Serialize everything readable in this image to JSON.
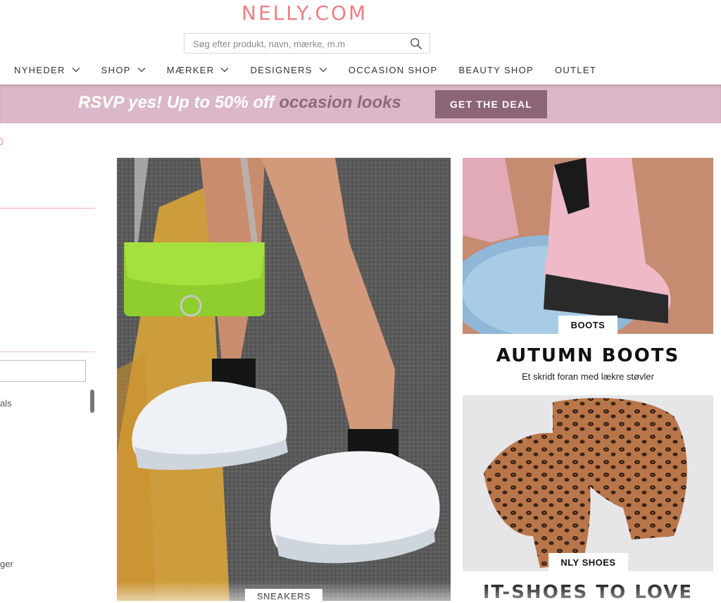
{
  "brand": {
    "logo": "NELLY.COM",
    "color": "#f07c84"
  },
  "search": {
    "placeholder": "Søg efter produkt, navn, mærke, m.m",
    "icon": "search-icon"
  },
  "nav": {
    "items": [
      {
        "label": "NYHEDER",
        "dropdown": true
      },
      {
        "label": "SHOP",
        "dropdown": true
      },
      {
        "label": "MÆRKER",
        "dropdown": true
      },
      {
        "label": "DESIGNERS",
        "dropdown": true
      },
      {
        "label": "OCCASION SHOP",
        "dropdown": false
      },
      {
        "label": "BEAUTY SHOP",
        "dropdown": false
      },
      {
        "label": "OUTLET",
        "dropdown": false
      }
    ]
  },
  "promo": {
    "text_main": "RSVP yes! Up to 50% off ",
    "text_accent": "occasion looks",
    "button_label": "GET THE DEAL",
    "bg_color": "#dbb8c7",
    "button_color": "#8c6577"
  },
  "sidebar": {
    "fragment_text_1": "als",
    "fragment_text_2": "ger"
  },
  "tiles": {
    "sneakers": {
      "badge": "SNEAKERS"
    },
    "boots": {
      "badge": "BOOTS",
      "headline": "AUTUMN BOOTS",
      "subline": "Et skridt foran med lækre støvler"
    },
    "leopard": {
      "badge": "NLY SHOES",
      "headline": "IT-SHOES TO LOVE"
    }
  }
}
